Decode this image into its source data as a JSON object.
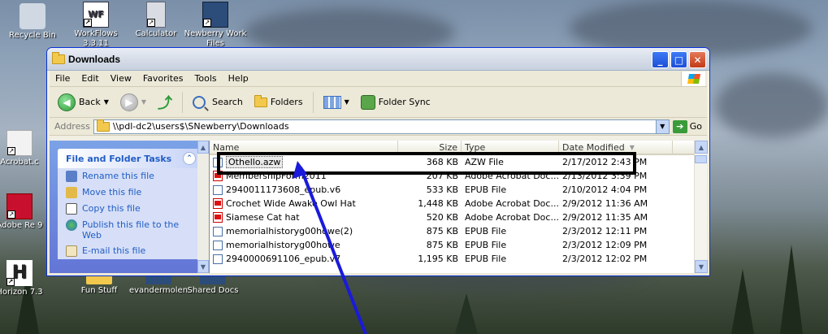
{
  "desktop": {
    "icons": [
      {
        "label": "Recycle Bin"
      },
      {
        "label": "WorkFlows 3.3.11"
      },
      {
        "label": "Calculator"
      },
      {
        "label": "Newberry Work Files"
      },
      {
        "label": "Acrobat.c"
      },
      {
        "label": "Adobe Re 9"
      },
      {
        "label": "Horizon 7.3"
      },
      {
        "label": "Fun Stuff"
      },
      {
        "label": "evandermolen"
      },
      {
        "label": "Shared Docs"
      }
    ]
  },
  "window": {
    "title": "Downloads",
    "menu": [
      "File",
      "Edit",
      "View",
      "Favorites",
      "Tools",
      "Help"
    ],
    "toolbar": {
      "back": "Back",
      "search": "Search",
      "folders": "Folders",
      "folder_sync": "Folder Sync"
    },
    "address": {
      "label": "Address",
      "path": "\\\\pdl-dc2\\users$\\SNewberry\\Downloads",
      "go": "Go"
    },
    "tasks": {
      "title": "File and Folder Tasks",
      "items": [
        "Rename this file",
        "Move this file",
        "Copy this file",
        "Publish this file to the Web",
        "E-mail this file"
      ]
    },
    "columns": {
      "name": "Name",
      "size": "Size",
      "type": "Type",
      "date": "Date Modified"
    },
    "files": [
      {
        "name": "Othello.azw",
        "size": "368 KB",
        "type": "AZW File",
        "date": "2/17/2012 2:43 PM",
        "icon": "epub"
      },
      {
        "name": "MembershipForm2011",
        "size": "207 KB",
        "type": "Adobe Acrobat Doc...",
        "date": "2/13/2012 3:39 PM",
        "icon": "pdf"
      },
      {
        "name": "2940011173608_epub.v6",
        "size": "533 KB",
        "type": "EPUB File",
        "date": "2/10/2012 4:04 PM",
        "icon": "epub"
      },
      {
        "name": "Crochet Wide Awake Owl Hat",
        "size": "1,448 KB",
        "type": "Adobe Acrobat Doc...",
        "date": "2/9/2012 11:36 AM",
        "icon": "pdf"
      },
      {
        "name": "Siamese Cat hat",
        "size": "520 KB",
        "type": "Adobe Acrobat Doc...",
        "date": "2/9/2012 11:35 AM",
        "icon": "pdf"
      },
      {
        "name": "memorialhistoryg00howe(2)",
        "size": "875 KB",
        "type": "EPUB File",
        "date": "2/3/2012 12:11 PM",
        "icon": "epub"
      },
      {
        "name": "memorialhistoryg00howe",
        "size": "875 KB",
        "type": "EPUB File",
        "date": "2/3/2012 12:09 PM",
        "icon": "epub"
      },
      {
        "name": "2940000691106_epub.v7",
        "size": "1,195 KB",
        "type": "EPUB File",
        "date": "2/3/2012 12:02 PM",
        "icon": "epub"
      }
    ]
  },
  "colors": {
    "highlight_box": "#000000",
    "arrow": "#1a1adb"
  }
}
